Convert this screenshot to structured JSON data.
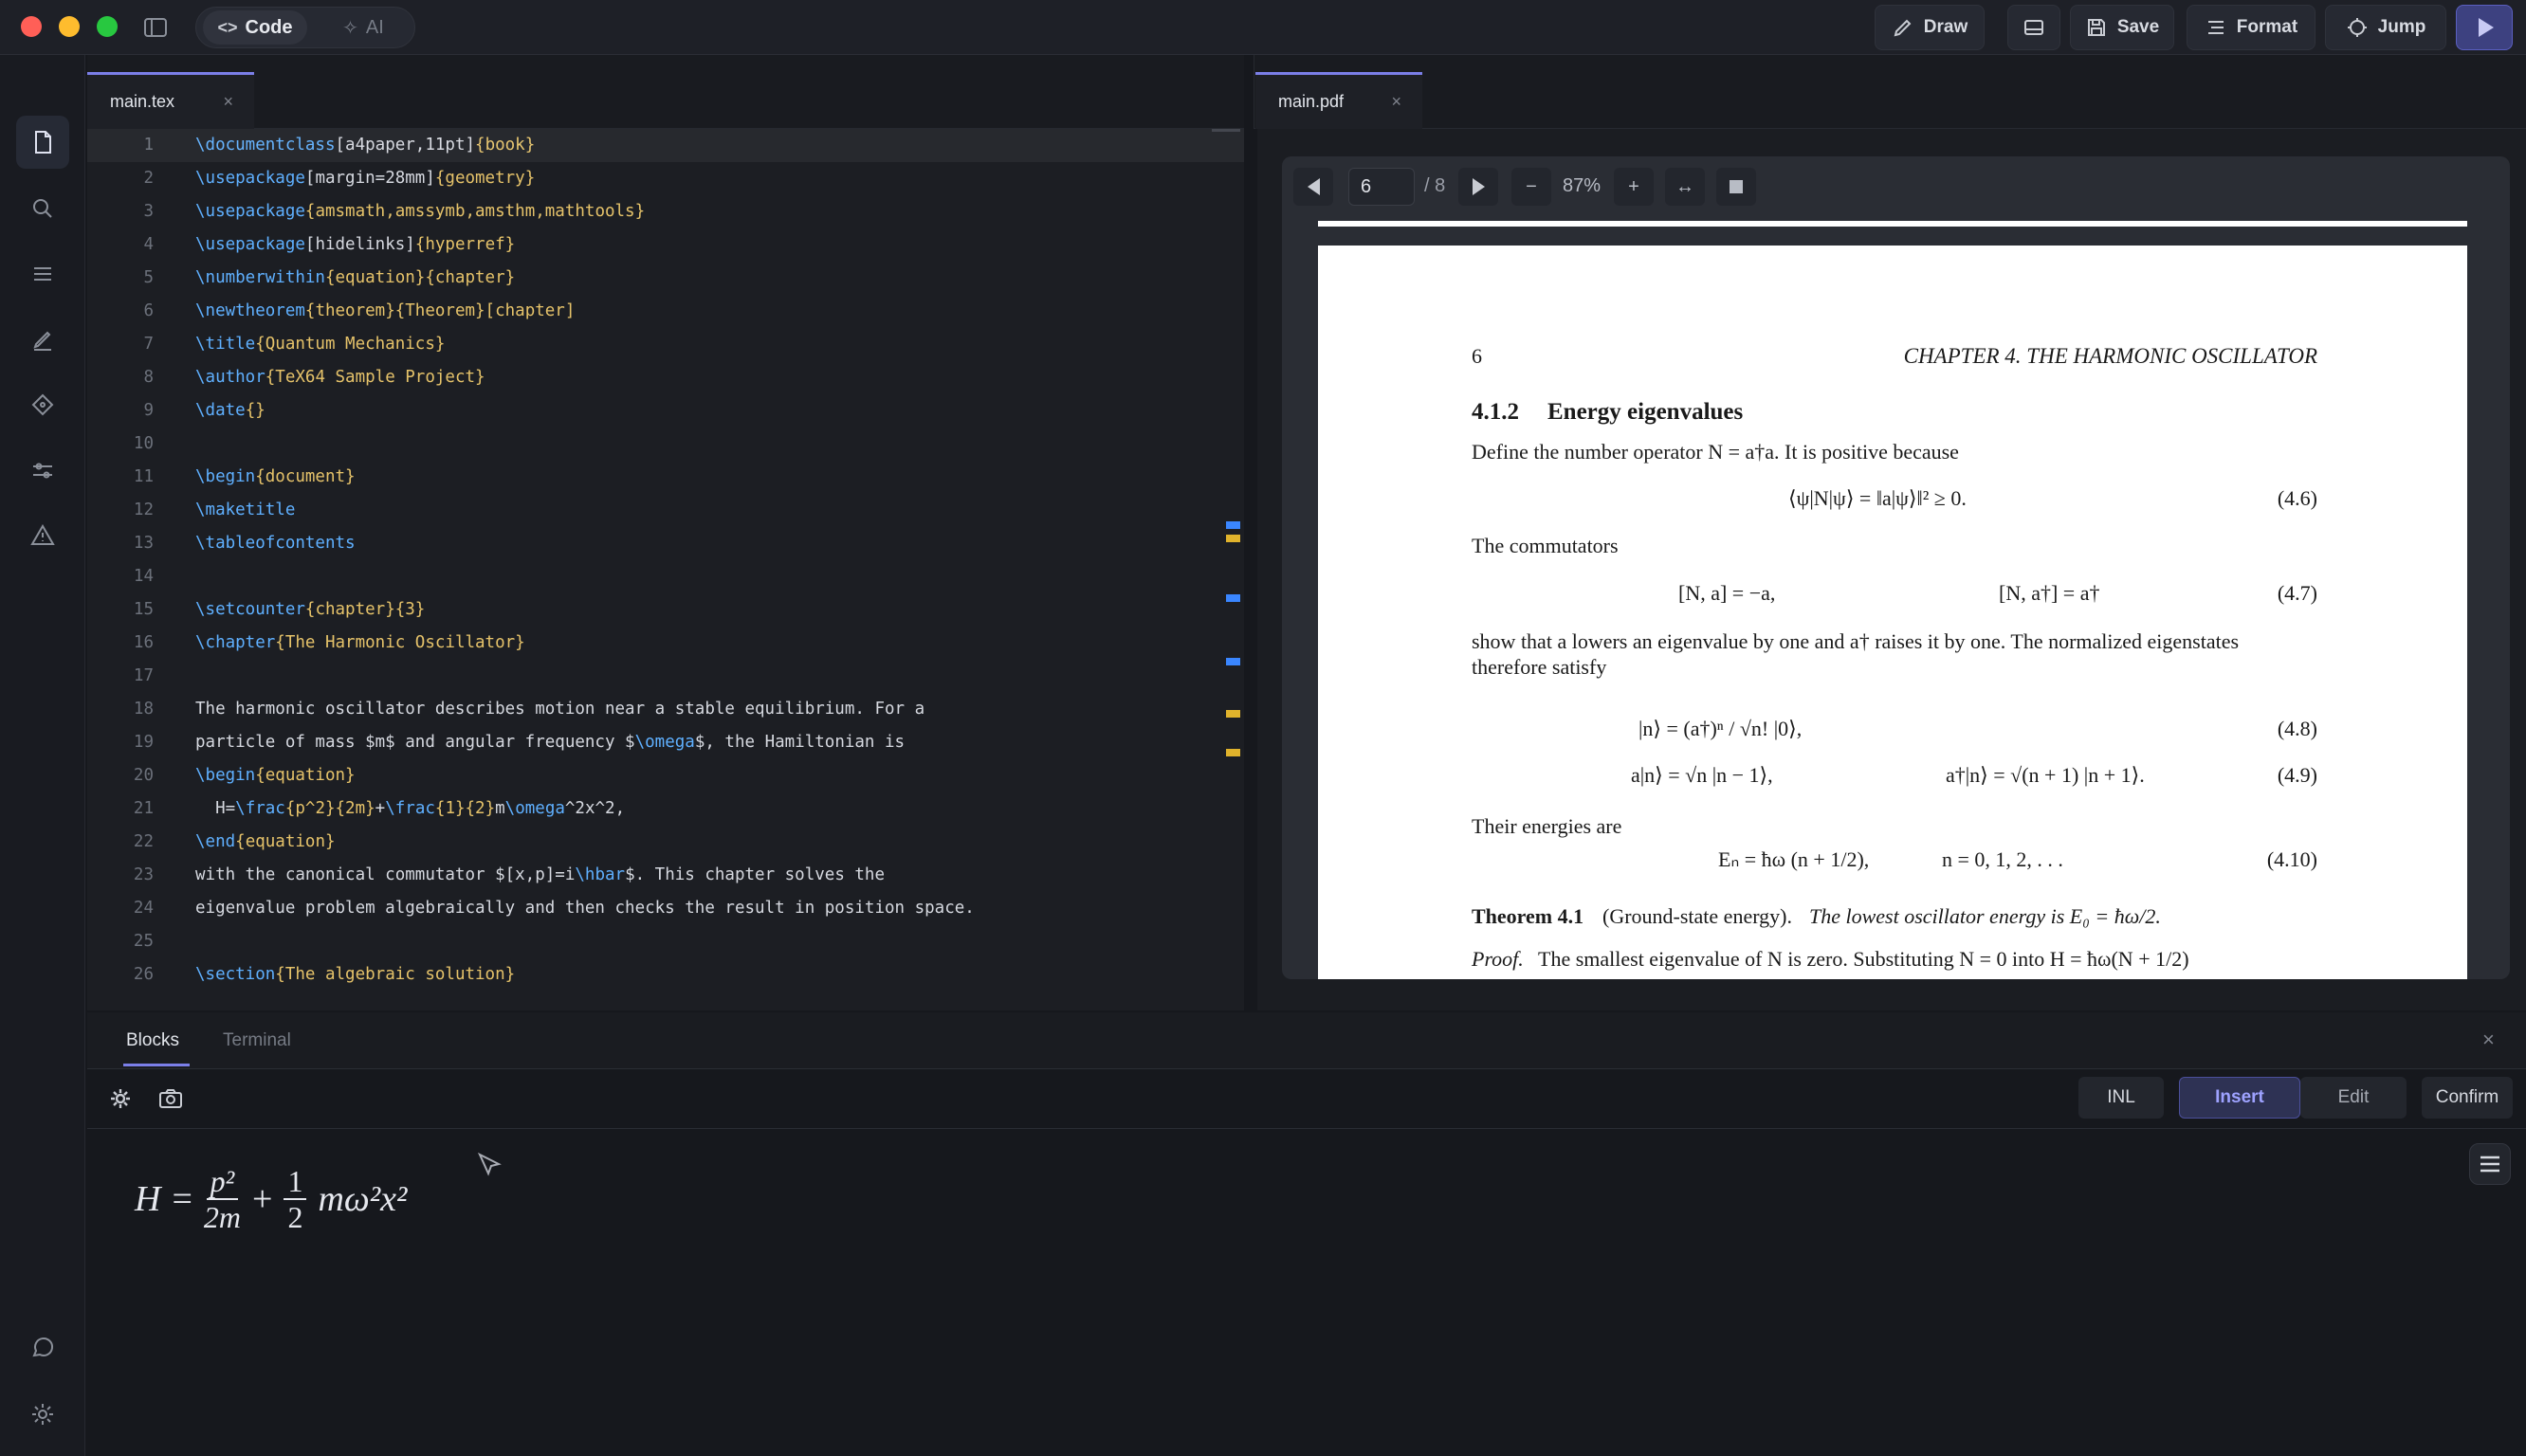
{
  "titlebar": {
    "mode_code": "Code",
    "mode_ai": "AI",
    "draw": "Draw",
    "save": "Save",
    "format": "Format",
    "jump": "Jump"
  },
  "editor": {
    "tab": "main.tex",
    "lines": [
      {
        "n": "1",
        "parts": [
          [
            "cmd",
            "\\documentclass"
          ],
          [
            "opt",
            "[a4paper,11pt]"
          ],
          [
            "arg",
            "{book}"
          ]
        ]
      },
      {
        "n": "2",
        "parts": [
          [
            "cmd",
            "\\usepackage"
          ],
          [
            "opt",
            "[margin=28mm]"
          ],
          [
            "arg",
            "{geometry}"
          ]
        ]
      },
      {
        "n": "3",
        "parts": [
          [
            "cmd",
            "\\usepackage"
          ],
          [
            "arg",
            "{amsmath,amssymb,amsthm,mathtools}"
          ]
        ]
      },
      {
        "n": "4",
        "parts": [
          [
            "cmd",
            "\\usepackage"
          ],
          [
            "opt",
            "[hidelinks]"
          ],
          [
            "arg",
            "{hyperref}"
          ]
        ]
      },
      {
        "n": "5",
        "parts": [
          [
            "cmd",
            "\\numberwithin"
          ],
          [
            "arg",
            "{equation}{chapter}"
          ]
        ]
      },
      {
        "n": "6",
        "parts": [
          [
            "cmd",
            "\\newtheorem"
          ],
          [
            "arg",
            "{theorem}{Theorem}[chapter]"
          ]
        ]
      },
      {
        "n": "7",
        "parts": [
          [
            "cmd",
            "\\title"
          ],
          [
            "arg",
            "{Quantum Mechanics}"
          ]
        ]
      },
      {
        "n": "8",
        "parts": [
          [
            "cmd",
            "\\author"
          ],
          [
            "arg",
            "{TeX64 Sample Project}"
          ]
        ]
      },
      {
        "n": "9",
        "parts": [
          [
            "cmd",
            "\\date"
          ],
          [
            "arg",
            "{}"
          ]
        ]
      },
      {
        "n": "10",
        "parts": []
      },
      {
        "n": "11",
        "parts": [
          [
            "cmd",
            "\\begin"
          ],
          [
            "arg",
            "{document}"
          ]
        ]
      },
      {
        "n": "12",
        "parts": [
          [
            "cmd",
            "\\maketitle"
          ]
        ]
      },
      {
        "n": "13",
        "parts": [
          [
            "cmd",
            "\\tableofcontents"
          ]
        ]
      },
      {
        "n": "14",
        "parts": []
      },
      {
        "n": "15",
        "parts": [
          [
            "cmd",
            "\\setcounter"
          ],
          [
            "arg",
            "{chapter}{3}"
          ]
        ]
      },
      {
        "n": "16",
        "parts": [
          [
            "cmd",
            "\\chapter"
          ],
          [
            "arg",
            "{The Harmonic Oscillator}"
          ]
        ]
      },
      {
        "n": "17",
        "parts": []
      },
      {
        "n": "18",
        "parts": [
          [
            "opt",
            "The harmonic oscillator describes motion near a stable equilibrium. For a"
          ]
        ]
      },
      {
        "n": "19",
        "parts": [
          [
            "opt",
            "particle of mass $m$ and angular frequency $"
          ],
          [
            "cmd",
            "\\omega"
          ],
          [
            "opt",
            "$, the Hamiltonian is"
          ]
        ]
      },
      {
        "n": "20",
        "parts": [
          [
            "cmd",
            "\\begin"
          ],
          [
            "arg",
            "{equation}"
          ]
        ]
      },
      {
        "n": "21",
        "parts": [
          [
            "opt",
            "  H="
          ],
          [
            "cmd",
            "\\frac"
          ],
          [
            "arg",
            "{p^2}{2m}"
          ],
          [
            "opt",
            "+"
          ],
          [
            "cmd",
            "\\frac"
          ],
          [
            "arg",
            "{1}{2}"
          ],
          [
            "opt",
            "m"
          ],
          [
            "cmd",
            "\\omega"
          ],
          [
            "opt",
            "^2x^2,"
          ]
        ]
      },
      {
        "n": "22",
        "parts": [
          [
            "cmd",
            "\\end"
          ],
          [
            "arg",
            "{equation}"
          ]
        ]
      },
      {
        "n": "23",
        "parts": [
          [
            "opt",
            "with the canonical commutator $[x,p]=i"
          ],
          [
            "cmd",
            "\\hbar"
          ],
          [
            "opt",
            "$. This chapter solves the"
          ]
        ]
      },
      {
        "n": "24",
        "parts": [
          [
            "opt",
            "eigenvalue problem algebraically and then checks the result in position space."
          ]
        ]
      },
      {
        "n": "25",
        "parts": []
      },
      {
        "n": "26",
        "parts": [
          [
            "cmd",
            "\\section"
          ],
          [
            "arg",
            "{The algebraic solution}"
          ]
        ]
      }
    ]
  },
  "pdf": {
    "tab": "main.pdf",
    "page_input": "6",
    "page_total": "/ 8",
    "zoom": "87%",
    "page": {
      "page_number": "6",
      "running_head": "CHAPTER 4.  THE HARMONIC OSCILLATOR",
      "section_num": "4.1.2",
      "section_title": "Energy eigenvalues",
      "p1": "Define the number operator N = a†a. It is positive because",
      "eq46": "⟨ψ|N|ψ⟩ = ‖a|ψ⟩‖² ≥ 0.",
      "eq46_num": "(4.6)",
      "p2": "The commutators",
      "eq47a": "[N, a] = −a,",
      "eq47b": "[N, a†] = a†",
      "eq47_num": "(4.7)",
      "p3a": "show that a lowers an eigenvalue by one and a† raises it by one. The normalized eigenstates",
      "p3b": "therefore satisfy",
      "eq48": "|n⟩ = (a†)ⁿ / √n! |0⟩,",
      "eq48_num": "(4.8)",
      "eq49a": "a|n⟩ = √n |n − 1⟩,",
      "eq49b": "a†|n⟩ = √(n + 1) |n + 1⟩.",
      "eq49_num": "(4.9)",
      "p4": "Their energies are",
      "eq410a": "Eₙ = ħω (n + 1/2),",
      "eq410b": "n = 0, 1, 2, . . .",
      "eq410_num": "(4.10)",
      "thm_label": "Theorem 4.1",
      "thm_name": "(Ground-state energy).",
      "thm_text": "The lowest oscillator energy is E₀ = ħω/2.",
      "proof_label": "Proof.",
      "proof_text": "The smallest eigenvalue of N is zero.  Substituting N = 0 into H = ħω(N + 1/2)"
    }
  },
  "bottom": {
    "tab_blocks": "Blocks",
    "tab_terminal": "Terminal",
    "mode_inl": "INL",
    "mode_insert": "Insert",
    "mode_edit": "Edit",
    "confirm": "Confirm",
    "formula": {
      "lhs": "H",
      "eq": "=",
      "num1": "p²",
      "den1": "2m",
      "plus": "+",
      "num2": "1",
      "den2": "2",
      "tail": "mω²x²"
    }
  },
  "colors": {
    "accent": "#7b7fe8",
    "command": "#5fb0ff",
    "argument": "#e6c36a",
    "marker_blue": "#3a86ff",
    "marker_yellow": "#e0b32c"
  }
}
